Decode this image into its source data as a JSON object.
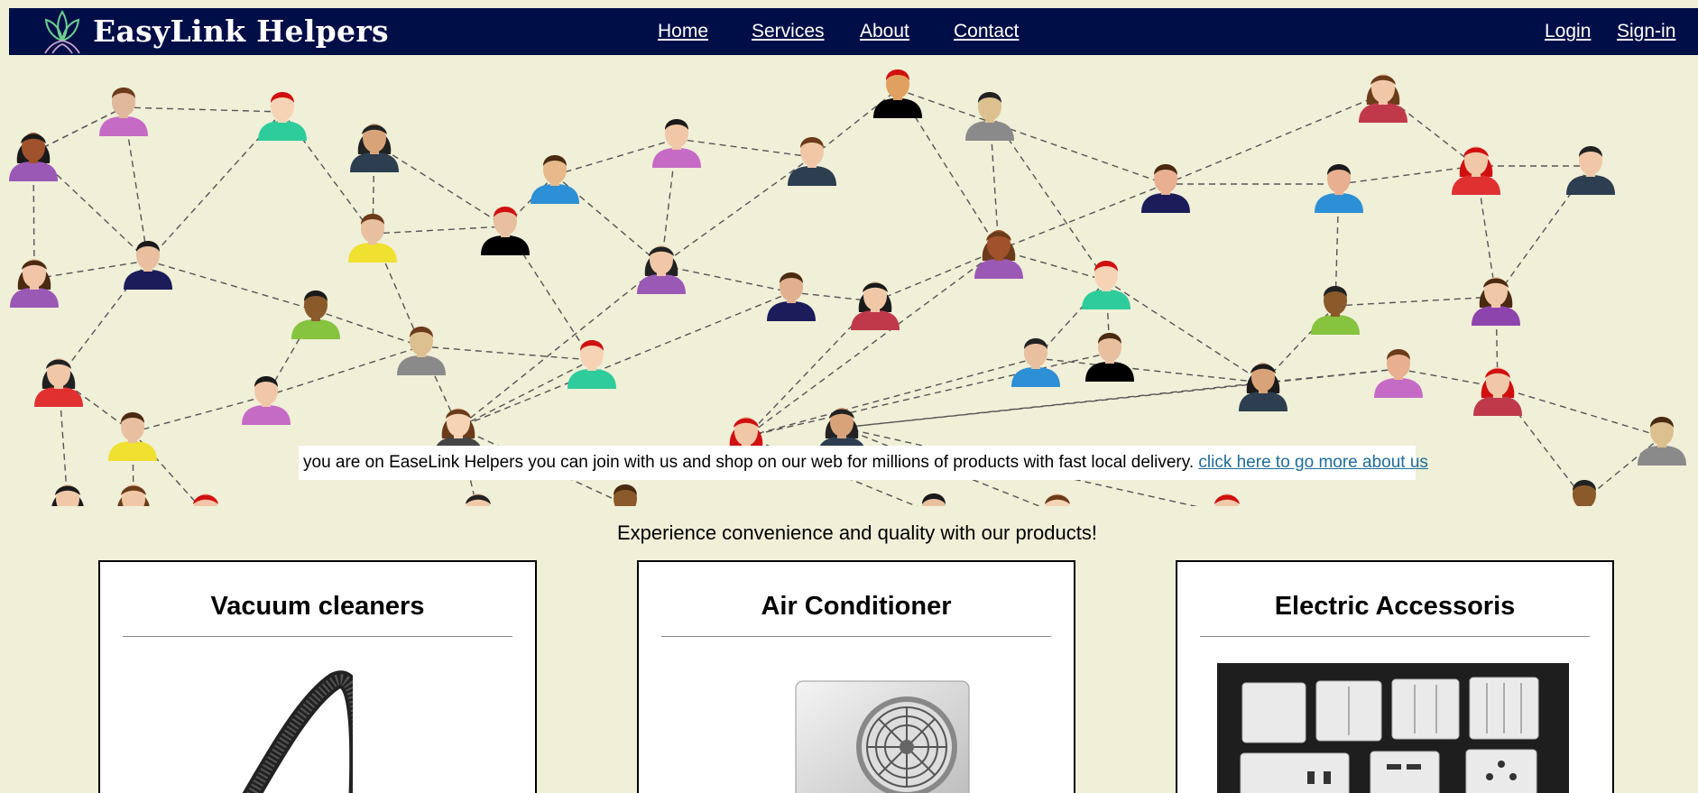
{
  "brand": {
    "name": "EasyLink Helpers"
  },
  "nav": {
    "links": [
      "Home",
      "Services",
      "About",
      "Contact"
    ],
    "auth": [
      "Login",
      "Sign-in"
    ]
  },
  "hero": {
    "banner_text": "you are on EaseLink Helpers you can join with us and shop on our web for millions of products with fast local delivery.",
    "banner_link": "click here to go more about us"
  },
  "tagline": "Experience convenience and quality with our products!",
  "products": [
    {
      "title": "Vacuum cleaners"
    },
    {
      "title": "Air Conditioner"
    },
    {
      "title": "Electric Accessoris"
    }
  ],
  "colors": {
    "navbar": "#000e48",
    "background": "#f0efd8",
    "link": "#1d6c99"
  }
}
